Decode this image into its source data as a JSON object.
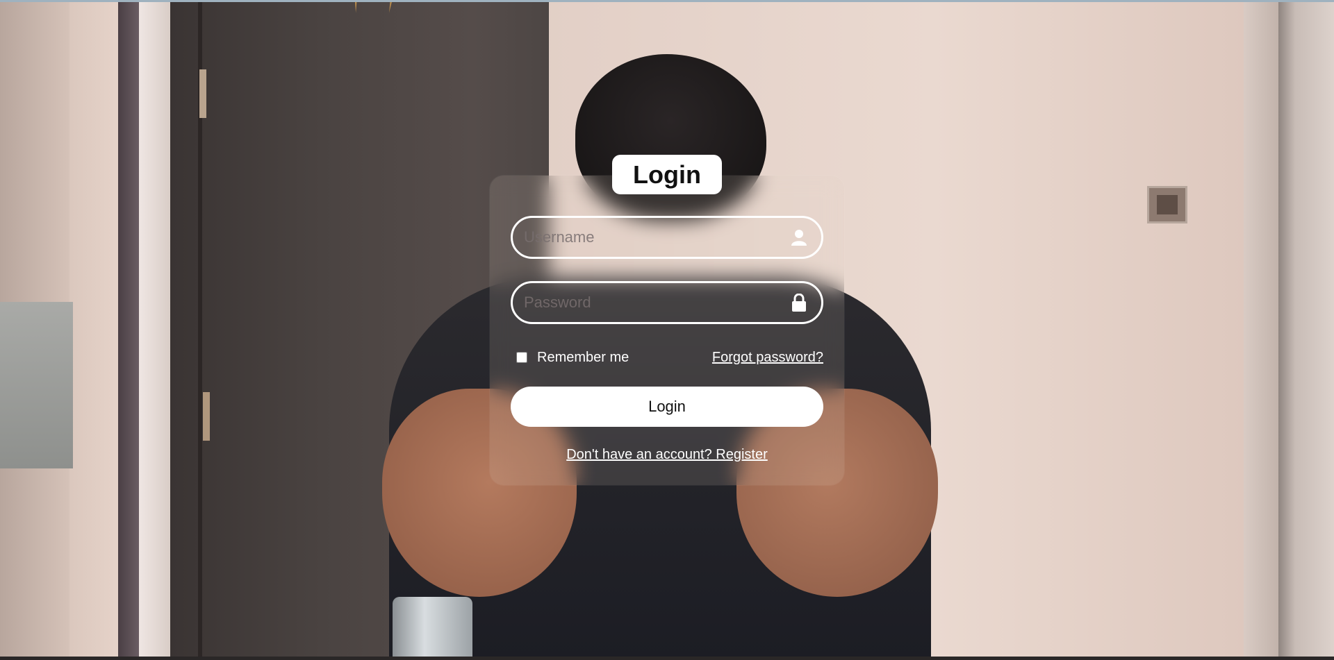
{
  "login": {
    "title": "Login",
    "username": {
      "placeholder": "Username",
      "value": "",
      "icon": "user-icon"
    },
    "password": {
      "placeholder": "Password",
      "value": "",
      "icon": "lock-icon"
    },
    "remember_label": "Remember me",
    "remember_checked": false,
    "forgot_label": "Forgot password?",
    "submit_label": "Login",
    "register_label": "Don't have an account? Register"
  },
  "colors": {
    "card_text": "#ffffff",
    "button_bg": "#ffffff",
    "button_text": "#111111"
  }
}
